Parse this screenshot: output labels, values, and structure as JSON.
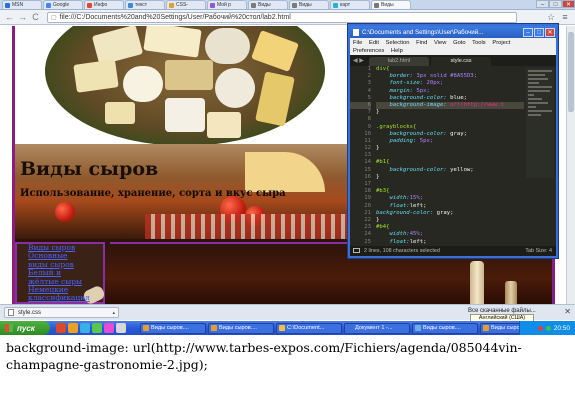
{
  "browser": {
    "tabs": [
      {
        "label": "MSN",
        "color": "#2a6fd8",
        "active": false
      },
      {
        "label": "Google",
        "color": "#4285f4",
        "active": false
      },
      {
        "label": "Инфо",
        "color": "#e04a2a",
        "active": false
      },
      {
        "label": "текст",
        "color": "#3b8ad8",
        "active": false
      },
      {
        "label": "CSS-",
        "color": "#e0a02a",
        "active": false
      },
      {
        "label": "Мой р",
        "color": "#8a5ad8",
        "active": false
      },
      {
        "label": "Виды",
        "color": "#7a7a7a",
        "active": false
      },
      {
        "label": "Виды",
        "color": "#7a7a7a",
        "active": false
      },
      {
        "label": "карт",
        "color": "#2ab0d8",
        "active": false
      },
      {
        "label": "Виды",
        "color": "#7a7a7a",
        "active": true
      }
    ],
    "window_buttons": [
      "–",
      "□",
      "✕"
    ],
    "url": "file:///C:/Documents%20and%20Settings/User/Рабочий%20стол/lab2.html",
    "nav": {
      "back": "←",
      "forward": "→",
      "reload": "C"
    },
    "toolbar_icons": [
      "☆",
      "≡"
    ]
  },
  "page": {
    "title": "Виды сыров",
    "subtitle": "Использование, хранение, сорта и вкус сыра",
    "menu": [
      "Виды сыров",
      "Основные",
      "виды сыров",
      "Белый и",
      "жёлтые сыры",
      "Немецкие",
      "классификация"
    ]
  },
  "editor": {
    "title": "C:\\Documents and Settings\\User\\Рабочий...",
    "window_buttons": [
      "–",
      "□",
      "✕"
    ],
    "menu": [
      "File",
      "Edit",
      "Selection",
      "Find",
      "View",
      "Goto",
      "Tools",
      "Project",
      "Preferences",
      "Help"
    ],
    "tab_arrows": "◀ ▶",
    "tabs": [
      {
        "label": "lab2.html",
        "active": false
      },
      {
        "label": "style.css",
        "active": true
      }
    ],
    "line_numbers": [
      "1",
      "2",
      "3",
      "4",
      "5",
      "6",
      "7",
      "8",
      "9",
      "10",
      "11",
      "12",
      "13",
      "14",
      "15",
      "16",
      "17",
      "18",
      "19",
      "20",
      "21",
      "22",
      "23",
      "24",
      "25"
    ],
    "lines": [
      [
        {
          "t": "div{",
          "c": "sel"
        }
      ],
      [
        {
          "t": "    border: ",
          "c": "prop"
        },
        {
          "t": "3px solid #8A55D3;",
          "c": "val"
        }
      ],
      [
        {
          "t": "    font-size: ",
          "c": "prop"
        },
        {
          "t": "20px;",
          "c": "val"
        }
      ],
      [
        {
          "t": "    margin: ",
          "c": "prop"
        },
        {
          "t": "5px;",
          "c": "val"
        }
      ],
      [
        {
          "t": "    background-color: ",
          "c": "prop"
        },
        {
          "t": "blue;",
          "c": ""
        }
      ],
      [
        {
          "t": "    background-image: ",
          "c": "prop"
        },
        {
          "t": "url(http://www.t",
          "c": "kw"
        }
      ],
      [
        {
          "t": "}",
          "c": ""
        }
      ],
      [
        {
          "t": "",
          "c": ""
        }
      ],
      [
        {
          "t": ".grayblocks{",
          "c": "sel"
        }
      ],
      [
        {
          "t": "    background-color: ",
          "c": "prop"
        },
        {
          "t": "gray;",
          "c": ""
        }
      ],
      [
        {
          "t": "    padding: ",
          "c": "prop"
        },
        {
          "t": "5px;",
          "c": "val"
        }
      ],
      [
        {
          "t": "}",
          "c": ""
        }
      ],
      [
        {
          "t": "",
          "c": ""
        }
      ],
      [
        {
          "t": "#b1{",
          "c": "sel"
        }
      ],
      [
        {
          "t": "    background-color: ",
          "c": "prop"
        },
        {
          "t": "yellow;",
          "c": ""
        }
      ],
      [
        {
          "t": "}",
          "c": ""
        }
      ],
      [
        {
          "t": "",
          "c": ""
        }
      ],
      [
        {
          "t": "#b3{",
          "c": "sel"
        }
      ],
      [
        {
          "t": "    width:",
          "c": "prop"
        },
        {
          "t": "15%;",
          "c": "val"
        }
      ],
      [
        {
          "t": "    float:",
          "c": "prop"
        },
        {
          "t": "left;",
          "c": ""
        }
      ],
      [
        {
          "t": "background-color: ",
          "c": "prop"
        },
        {
          "t": "gray;",
          "c": ""
        }
      ],
      [
        {
          "t": "}",
          "c": ""
        }
      ],
      [
        {
          "t": "#b4{",
          "c": "sel"
        }
      ],
      [
        {
          "t": "    width:",
          "c": "prop"
        },
        {
          "t": "45%;",
          "c": "val"
        }
      ],
      [
        {
          "t": "    float:",
          "c": "prop"
        },
        {
          "t": "left;",
          "c": ""
        }
      ]
    ],
    "highlighted_line": 6,
    "status_text": "2 lines, 108 characters selected",
    "tab_size": "Tab Size: 4"
  },
  "downloads": {
    "file": "style.css",
    "caret": "▴",
    "show_all": "Все скачанные файлы...",
    "close": "✕"
  },
  "tooltip": "Английский (США)",
  "taskbar": {
    "start": "пуск",
    "tasks": [
      {
        "label": "Виды сыров....",
        "color": "#e0a030"
      },
      {
        "label": "Виды сыров....",
        "color": "#e0a030"
      },
      {
        "label": "C:\\Document...",
        "color": "#f0c040"
      },
      {
        "label": "Документ 1 -...",
        "color": "#3a6fd8"
      },
      {
        "label": "Виды сыров....",
        "color": "#6ab0e0"
      },
      {
        "label": "Виды сыров....",
        "color": "#e0a030"
      }
    ],
    "quick_colors": [
      "#d84a2a",
      "#f0a020",
      "#3ab0e8",
      "#5ac84a",
      "#e84ad8",
      "#d8d8d8"
    ],
    "clock": "20:50",
    "tray_colors": [
      "#e04040",
      "#40c040"
    ]
  },
  "caption": "background-image: url(http://www.tarbes-expos.com/Fichiers/agenda/085044vin-champagne-gastronomie-2.jpg);"
}
